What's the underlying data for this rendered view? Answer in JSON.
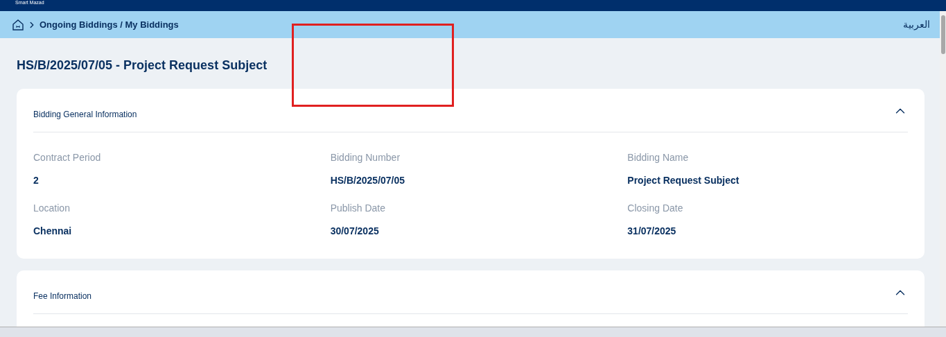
{
  "header": {
    "brand": "Smart Mazad"
  },
  "breadcrumb": {
    "path": "Ongoing Biddings / My Biddings",
    "language": "العربية"
  },
  "title": "HS/B/2025/07/05 - Project Request Subject",
  "sections": [
    {
      "title": "Bidding General Information",
      "expanded": true,
      "fields": [
        {
          "label": "Contract Period",
          "value": "2"
        },
        {
          "label": "Bidding Number",
          "value": "HS/B/2025/07/05"
        },
        {
          "label": "Bidding Name",
          "value": "Project Request Subject"
        },
        {
          "label": "Location",
          "value": "Chennai"
        },
        {
          "label": "Publish Date",
          "value": "30/07/2025"
        },
        {
          "label": "Closing Date",
          "value": "31/07/2025"
        }
      ]
    },
    {
      "title": "Fee Information",
      "expanded": true
    }
  ]
}
